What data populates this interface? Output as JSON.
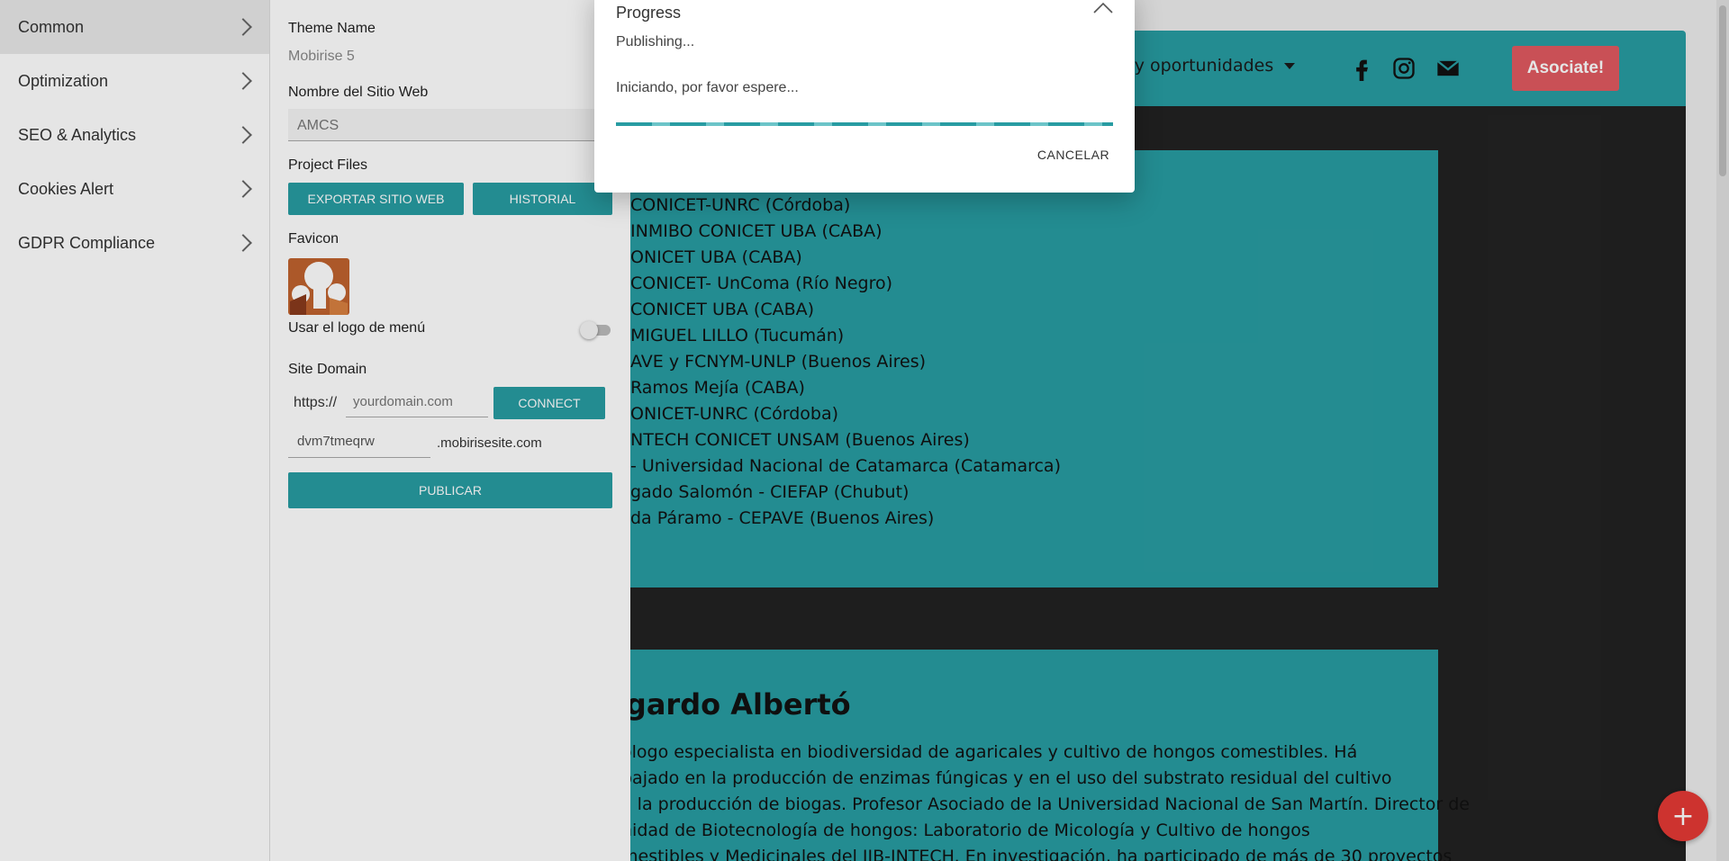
{
  "sidebar": {
    "items": [
      {
        "label": "Common"
      },
      {
        "label": "Optimization"
      },
      {
        "label": "SEO & Analytics"
      },
      {
        "label": "Cookies Alert"
      },
      {
        "label": "GDPR Compliance"
      }
    ]
  },
  "settings": {
    "theme_name_label": "Theme Name",
    "theme_name_value": "Mobirise 5",
    "site_name_label": "Nombre del Sitio Web",
    "site_name_value": "AMCS",
    "project_files_label": "Project Files",
    "export_button": "EXPORTAR SITIO WEB",
    "history_button": "HISTORIAL",
    "favicon_label": "Favicon",
    "menu_logo_label": "Usar el logo de menú",
    "site_domain_label": "Site Domain",
    "protocol": "https://",
    "domain_placeholder": "yourdomain.com",
    "connect_button": "CONNECT",
    "subdomain_value": "dvm7tmeqrw",
    "subdomain_suffix": ".mobirisesite.com",
    "publish_button": "PUBLICAR"
  },
  "dialog": {
    "title": "Progress",
    "status": "Publishing...",
    "message": "Iniciando, por favor espere...",
    "cancel": "CANCELAR"
  },
  "preview": {
    "nav_menu": "des y oportunidades",
    "join_button": "Asociate!",
    "members": [
      "CONICET-UNRC (Córdoba)",
      "INMIBO CONICET UBA (CABA)",
      "ONICET UBA (CABA)",
      "CONICET- UnComa (Río Negro)",
      "CONICET UBA (CABA)",
      "MIGUEL LILLO (Tucumán)",
      "AVE y FCNYM-UNLP (Buenos Aires)",
      "Ramos Mejía (CABA)",
      "ONICET-UNRC (Córdoba)",
      "NTECH CONICET UNSAM (Buenos Aires)",
      "- Universidad Nacional de Catamarca (Catamarca)",
      "gado Salomón - CIEFAP (Chubut)",
      "da Páramo - CEPAVE (Buenos Aires)"
    ],
    "bio_name": "dgardo Albertó",
    "bio_lines": [
      "ólogo especialista en biodiversidad de agaricales y cultivo de hongos comestibles. Há",
      "bajado en la producción de enzimas fúngicas y en el uso del substrato residual del cultivo",
      "a la producción de biogas. Profesor Asociado de la Universidad Nacional de San Martín. Director de",
      "nidad de Biotecnología de hongos: Laboratorio de Micología y Cultivo de hongos",
      "mestibles y Medicinales del IIB-INTECH. En investigación, ha participado de más de 30 proyectos"
    ],
    "fab_symbol": "+"
  },
  "colors": {
    "accent": "#289ca2",
    "join_button": "#e05a60",
    "fab": "#e53935"
  }
}
